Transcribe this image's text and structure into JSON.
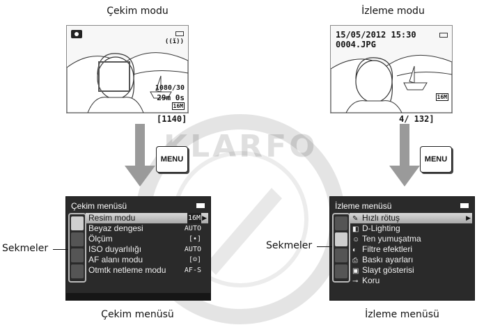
{
  "top_left_caption": "Çekim modu",
  "top_right_caption": "İzleme modu",
  "bottom_left_caption": "Çekim menüsü",
  "bottom_right_caption": "İzleme menüsü",
  "sekmeler_label": "Sekmeler",
  "menu_button_label": "MENU",
  "watermark_text": "KLARFO",
  "shooting_screen": {
    "mode_icon": "camera-icon",
    "resolution_badge": "1080/30",
    "remaining_time": "29m 0s",
    "image_mode_badge": "16M",
    "remaining_count": "[1140]"
  },
  "playback_screen": {
    "date_time": "15/05/2012  15:30",
    "file_name": "0004.JPG",
    "image_mode_badge": "16M",
    "frame_counter": "4/ 132]"
  },
  "shooting_menu": {
    "title": "Çekim menüsü",
    "items": [
      {
        "label": "Resim modu",
        "value": "16M",
        "selected": true
      },
      {
        "label": "Beyaz dengesi",
        "value": "AUTO"
      },
      {
        "label": "Ölçüm",
        "value": "[•]"
      },
      {
        "label": "ISO duyarlılığı",
        "value": "AUTO"
      },
      {
        "label": "AF alanı modu",
        "value": "[☺]"
      },
      {
        "label": "Otmtk netleme modu",
        "value": "AF-S"
      }
    ]
  },
  "playback_menu": {
    "title": "İzleme menüsü",
    "items": [
      {
        "label": "Hızlı rötuş",
        "icon": "retouch-icon",
        "selected": true
      },
      {
        "label": "D-Lighting",
        "icon": "d-lighting-icon"
      },
      {
        "label": "Ten yumuşatma",
        "icon": "skin-softening-icon"
      },
      {
        "label": "Filtre efektleri",
        "icon": "filter-icon"
      },
      {
        "label": "Baskı ayarları",
        "icon": "print-icon"
      },
      {
        "label": "Slayt gösterisi",
        "icon": "slideshow-icon"
      },
      {
        "label": "Koru",
        "icon": "key-icon"
      }
    ]
  },
  "colors": {
    "menu_bg": "#2a2a2a",
    "selected_bg": "#c4c4c4",
    "arrow_gray": "#9a9a9a"
  }
}
